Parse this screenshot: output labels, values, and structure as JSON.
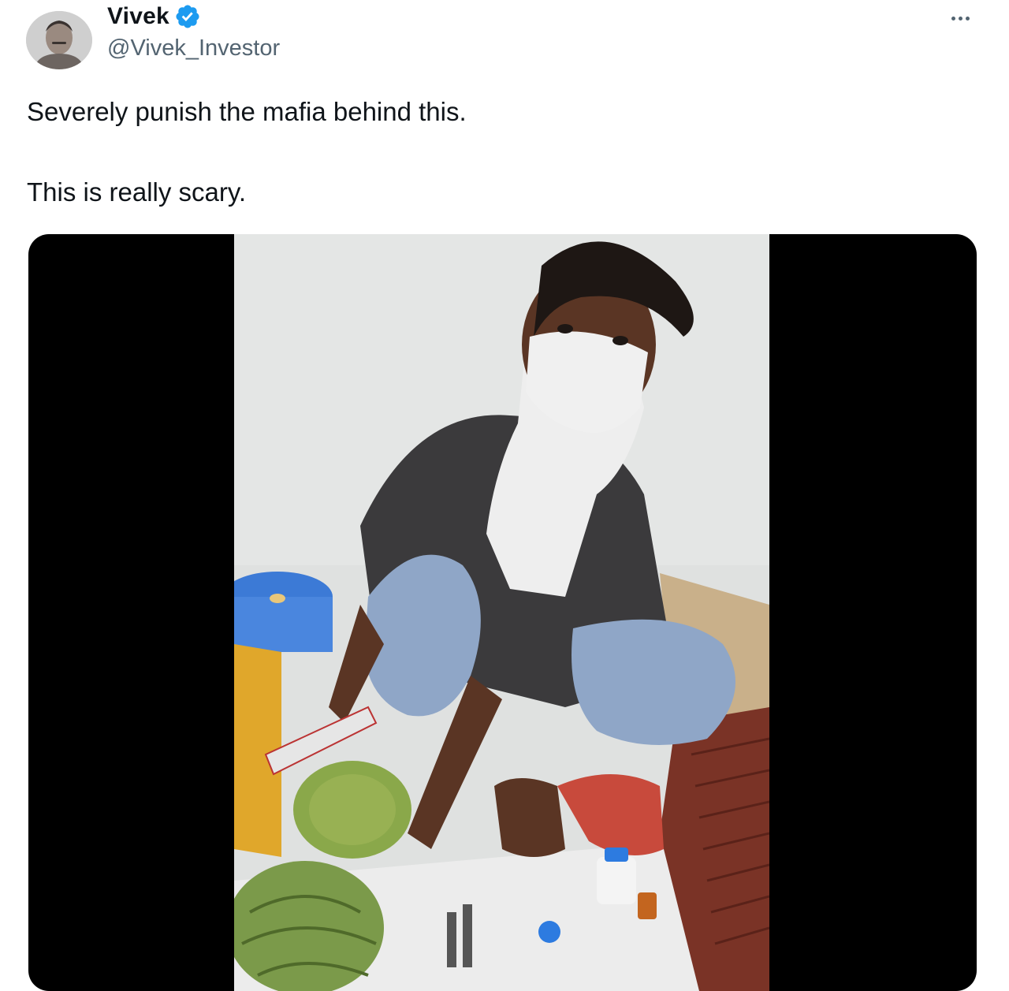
{
  "author": {
    "display_name": "Vivek",
    "handle": "@Vivek_Investor",
    "verified": true,
    "avatar_icon": "user-avatar"
  },
  "tweet": {
    "lines": [
      "Severely punish the mafia behind this.",
      "This is really scary."
    ]
  },
  "media": {
    "type": "video",
    "description_icon": "video-thumbnail"
  },
  "colors": {
    "verified_blue": "#1d9bf0",
    "text": "#0f1419",
    "secondary_text": "#536471",
    "media_background": "#000000"
  }
}
